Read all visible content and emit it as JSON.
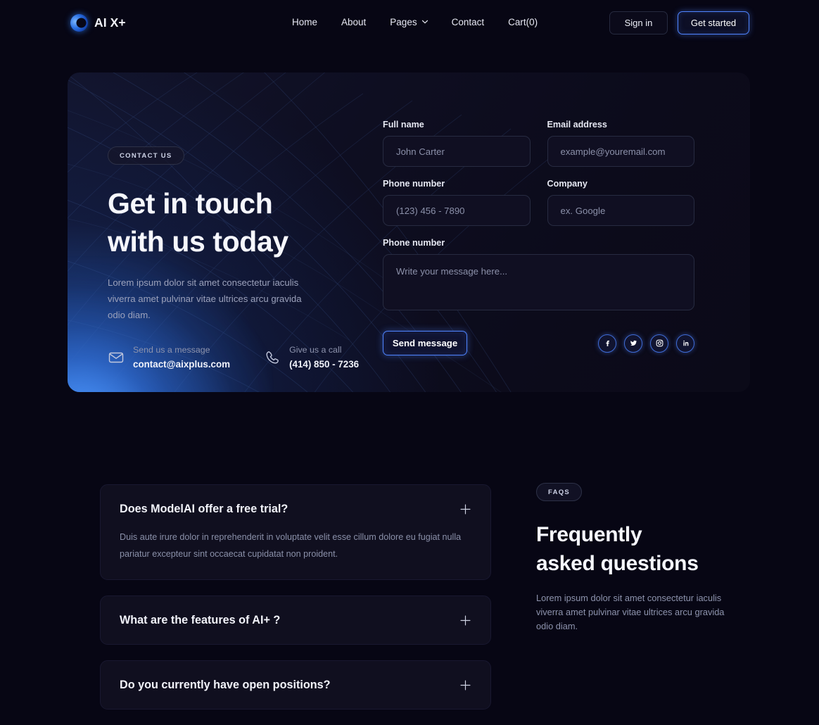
{
  "brand": {
    "name": "AI X+",
    "logo_icon": "ring-logo-icon",
    "accent": "#4f84ff"
  },
  "nav": {
    "items": [
      {
        "label": "Home"
      },
      {
        "label": "About"
      },
      {
        "label": "Pages",
        "icon": "chevron-down-icon"
      },
      {
        "label": "Contact"
      },
      {
        "label": "Cart(0)"
      }
    ],
    "sign_in": "Sign in",
    "get_started": "Get started"
  },
  "contact": {
    "badge": "CONTACT US",
    "title_line1": "Get in touch",
    "title_line2": "with us today",
    "lede": "Lorem ipsum dolor sit amet consectetur iaculis viverra amet pulvinar vitae ultrices arcu gravida odio diam.",
    "email": {
      "icon": "envelope-icon",
      "label": "Send us a message",
      "value": "contact@aixplus.com"
    },
    "phone": {
      "icon": "phone-icon",
      "label": "Give us a call",
      "value": "(414) 850 - 7236"
    }
  },
  "form": {
    "fields": {
      "full_name": {
        "label": "Full name",
        "placeholder": "John Carter"
      },
      "email": {
        "label": "Email address",
        "placeholder": "example@youremail.com"
      },
      "phone": {
        "label": "Phone number",
        "placeholder": "(123) 456 - 7890"
      },
      "company": {
        "label": "Company",
        "placeholder": "ex. Google"
      },
      "message": {
        "label": "Phone number",
        "placeholder": "Write your message here..."
      }
    },
    "submit": "Send message",
    "socials": [
      {
        "name": "facebook",
        "label": "f"
      },
      {
        "name": "twitter",
        "label": "t"
      },
      {
        "name": "instagram",
        "label": "i"
      },
      {
        "name": "linkedin",
        "label": "in"
      }
    ]
  },
  "faq": {
    "badge": "FAQS",
    "title_line1": "Frequently",
    "title_line2": "asked questions",
    "description": "Lorem ipsum dolor sit amet consectetur iaculis viverra amet pulvinar vitae ultrices arcu gravida odio diam.",
    "items": [
      {
        "question": "Does ModelAI offer a free trial?",
        "answer": "Duis aute irure dolor in reprehenderit in voluptate velit esse cillum dolore eu fugiat nulla pariatur excepteur sint occaecat cupidatat non proident.",
        "expanded": true
      },
      {
        "question": "What are the features of AI+ ?",
        "answer": "",
        "expanded": false
      },
      {
        "question": "Do you currently have open positions?",
        "answer": "",
        "expanded": false
      }
    ]
  }
}
